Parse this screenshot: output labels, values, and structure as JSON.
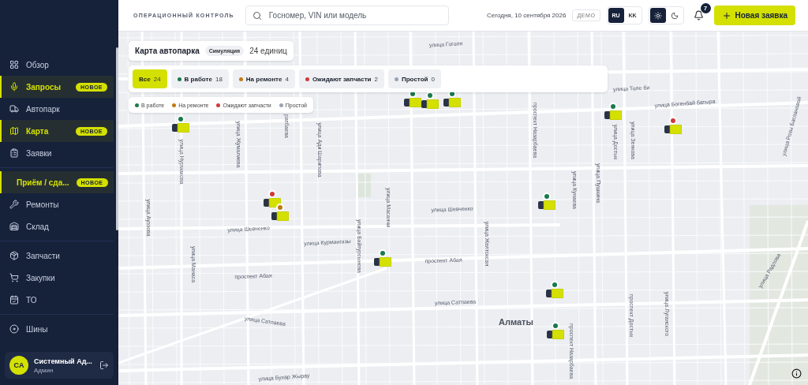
{
  "sidebar": {
    "sections": [
      [
        {
          "label": "Обзор",
          "highlighted": false
        },
        {
          "label": "Запросы",
          "highlighted": true,
          "badge": "НОВОЕ"
        },
        {
          "label": "Автопарк",
          "highlighted": false
        },
        {
          "label": "Карта",
          "highlighted": true,
          "badge": "НОВОЕ"
        },
        {
          "label": "Заявки",
          "highlighted": false
        }
      ],
      [
        {
          "label": "Приём / сда...",
          "highlighted": true,
          "badge": "НОВОЕ"
        },
        {
          "label": "Ремонты",
          "highlighted": false
        },
        {
          "label": "Склад",
          "highlighted": false
        }
      ],
      [
        {
          "label": "Запчасти",
          "highlighted": false
        },
        {
          "label": "Закупки",
          "highlighted": false
        },
        {
          "label": "ТО",
          "highlighted": false
        }
      ],
      [
        {
          "label": "Шины",
          "highlighted": false
        }
      ]
    ],
    "user": {
      "initials": "СА",
      "name": "Системный Ад...",
      "role": "Админ"
    }
  },
  "topbar": {
    "title": "ОПЕРАЦИОННЫЙ КОНТРОЛЬ",
    "search": {
      "placeholder": "Госномер, VIN или модель"
    },
    "date": "Сегодня, 10 сентября 2026",
    "mode_badge": "ДЕМО",
    "languages": [
      {
        "label": "RU",
        "selected": true
      },
      {
        "label": "KK",
        "selected": false
      }
    ],
    "theme": [
      {
        "kind": "light",
        "selected": true
      },
      {
        "kind": "dark",
        "selected": false
      }
    ],
    "notifications": "7",
    "new_button": "Новая заявка"
  },
  "map": {
    "title": "Карта автопарка",
    "mode": "Симуляция",
    "count": "24 единиц",
    "filters": [
      {
        "label": "Все",
        "count": "24",
        "selected": true
      },
      {
        "label": "В работе",
        "count": "18",
        "selected": false,
        "color": "#1a7a4c"
      },
      {
        "label": "На ремонте",
        "count": "4",
        "selected": false,
        "color": "#c07a10"
      },
      {
        "label": "Ожидают запчасти",
        "count": "2",
        "selected": false,
        "color": "#d03a3a"
      },
      {
        "label": "Простой",
        "count": "0",
        "selected": false,
        "color": "#9aa3b0"
      }
    ],
    "legend": [
      {
        "label": "В работе",
        "color": "#1a7a4c"
      },
      {
        "label": "На ремонте",
        "color": "#c07a10"
      },
      {
        "label": "Ожидают запчасти",
        "color": "#d03a3a"
      },
      {
        "label": "Простой",
        "color": "#9aa3b0"
      }
    ],
    "streets": [
      "улица Гоголя",
      "улица Толе би",
      "улица Богенбай батыра",
      "улица Розы Баглановой",
      "улица Нурмакова",
      "улица Жумалиева",
      "ратбаева",
      "улица Ади Шарипова",
      "улица Масанчи",
      "улица Шевченко",
      "улица Шевченко",
      "улица Курмангазы",
      "улица Байтурсынова",
      "улица Ауэзова",
      "улица Манаса",
      "проспект Абая",
      "проспект Абая",
      "улица Сатпаева",
      "улица Сатпаева",
      "проспект Назарбаева",
      "улица Желтоксан",
      "улица Кунаева",
      "улица Пушкина",
      "улица Достык",
      "улица Зенкова",
      "улица Радлова",
      "улица Луганского",
      "проспект Достык",
      "проспект Назарбаева",
      "улица Бухар Жырау"
    ],
    "city": "Алматы",
    "markers": [
      {
        "color": "#1a7a4c"
      },
      {
        "color": "#1a7a4c"
      },
      {
        "color": "#1a7a4c"
      },
      {
        "color": "#1a7a4c"
      },
      {
        "color": "#d03a3a"
      },
      {
        "color": "#c07a10"
      },
      {
        "color": "#1a7a4c"
      },
      {
        "color": "#1a7a4c"
      },
      {
        "color": "#1a7a4c"
      },
      {
        "color": "#d03a3a"
      },
      {
        "color": "#1a7a4c"
      },
      {
        "color": "#1a7a4c"
      }
    ]
  }
}
